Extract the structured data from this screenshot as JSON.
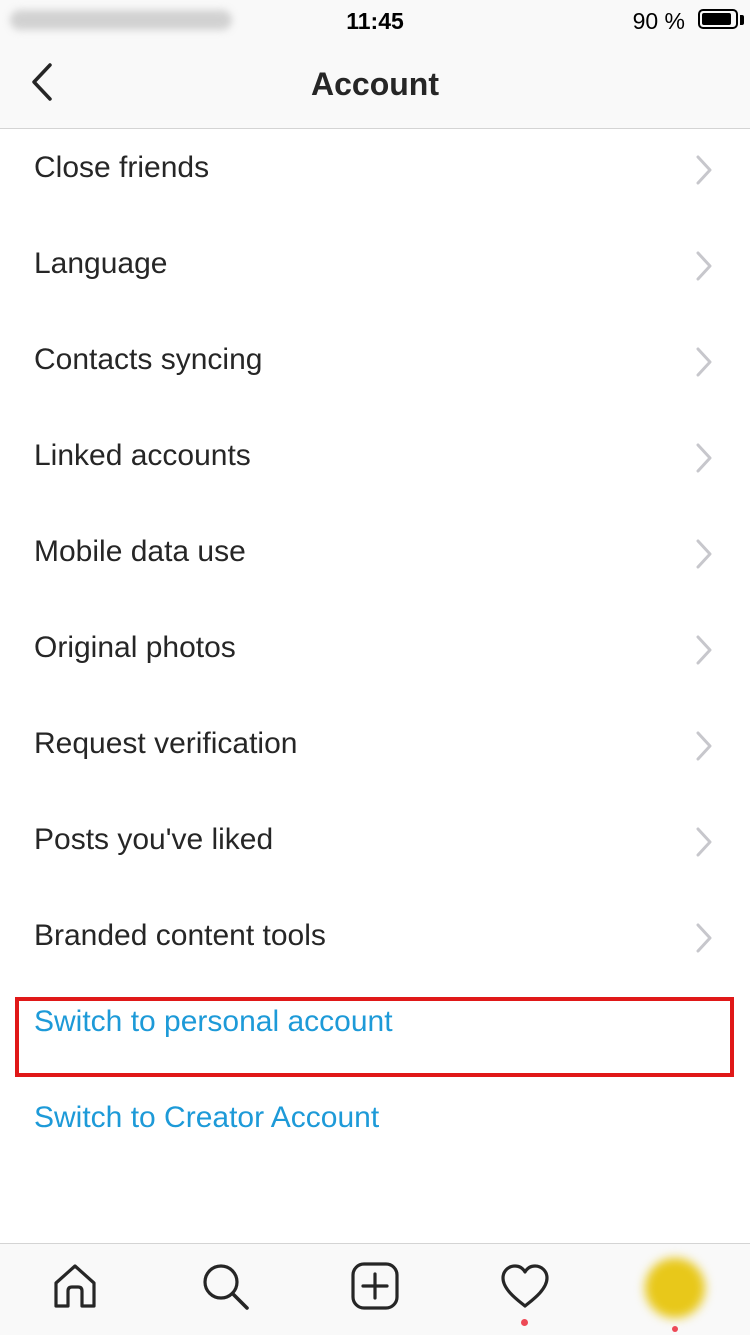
{
  "status_bar": {
    "time": "11:45",
    "battery_percent": "90 %",
    "battery_level": 0.9
  },
  "nav": {
    "title": "Account",
    "back_icon": "chevron-left-icon"
  },
  "menu": {
    "items": [
      {
        "label": "Close friends"
      },
      {
        "label": "Language"
      },
      {
        "label": "Contacts syncing"
      },
      {
        "label": "Linked accounts"
      },
      {
        "label": "Mobile data use"
      },
      {
        "label": "Original photos"
      },
      {
        "label": "Request verification"
      },
      {
        "label": "Posts you've liked"
      },
      {
        "label": "Branded content tools"
      }
    ],
    "links": [
      {
        "label": "Switch to personal account",
        "highlighted": true
      },
      {
        "label": "Switch to Creator Account",
        "highlighted": false
      }
    ],
    "link_color": "#1d9ad8",
    "highlight_color": "#e01818"
  },
  "tab_bar": {
    "tabs": [
      {
        "name": "home-icon"
      },
      {
        "name": "search-icon"
      },
      {
        "name": "new-post-icon"
      },
      {
        "name": "activity-heart-icon"
      },
      {
        "name": "profile-avatar"
      }
    ],
    "notification_color": "#ed4956"
  }
}
